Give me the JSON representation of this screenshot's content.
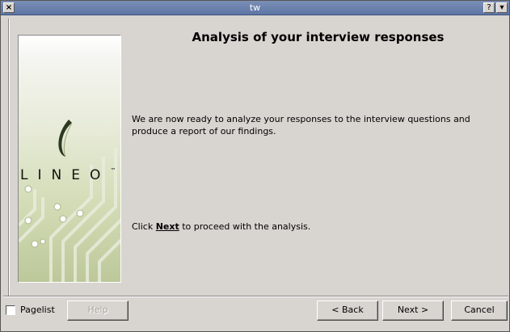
{
  "window": {
    "title": "tw",
    "close_glyph": "×",
    "help_glyph": "?",
    "menu_glyph": "▾"
  },
  "wizard": {
    "heading": "Analysis of your interview responses",
    "intro_text": "We are now ready to analyze your responses to the interview questions and produce a report of our findings.",
    "instruction_prefix": "Click ",
    "instruction_keyword": "Next",
    "instruction_suffix": " to proceed with the analysis."
  },
  "logo": {
    "text": "LINEO",
    "trademark": "™"
  },
  "controls": {
    "pagelist_label": "Pagelist",
    "pagelist_checked": false,
    "help_label": "Help",
    "help_enabled": false,
    "back_label": "< Back",
    "next_label": "Next >",
    "cancel_label": "Cancel"
  },
  "colors": {
    "titlebar": "#6a80ad",
    "dialog_bg": "#d8d4d0",
    "logo_green": "#c5d1a2"
  }
}
